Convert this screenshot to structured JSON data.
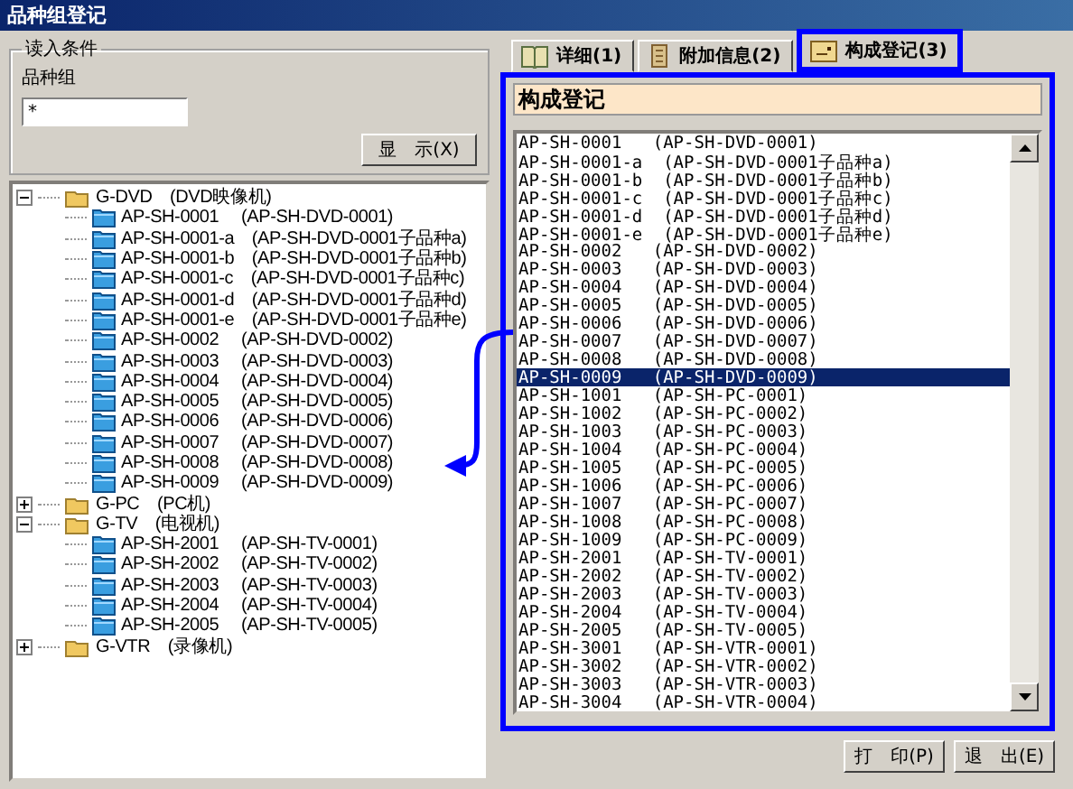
{
  "window": {
    "title": "品种组登记"
  },
  "query": {
    "legend": "读入条件",
    "field_label": "品种组",
    "field_value": "*",
    "button": "显　示(X)"
  },
  "tree": [
    {
      "label": "G-DVD　(DVD映像机)",
      "expanded": true,
      "children": [
        {
          "label": "AP-SH-0001　 (AP-SH-DVD-0001)"
        },
        {
          "label": "AP-SH-0001-a　(AP-SH-DVD-0001子品种a)"
        },
        {
          "label": "AP-SH-0001-b　(AP-SH-DVD-0001子品种b)"
        },
        {
          "label": "AP-SH-0001-c　(AP-SH-DVD-0001子品种c)"
        },
        {
          "label": "AP-SH-0001-d　(AP-SH-DVD-0001子品种d)"
        },
        {
          "label": "AP-SH-0001-e　(AP-SH-DVD-0001子品种e)"
        },
        {
          "label": "AP-SH-0002　 (AP-SH-DVD-0002)"
        },
        {
          "label": "AP-SH-0003　 (AP-SH-DVD-0003)"
        },
        {
          "label": "AP-SH-0004　 (AP-SH-DVD-0004)"
        },
        {
          "label": "AP-SH-0005　 (AP-SH-DVD-0005)"
        },
        {
          "label": "AP-SH-0006　 (AP-SH-DVD-0006)"
        },
        {
          "label": "AP-SH-0007　 (AP-SH-DVD-0007)"
        },
        {
          "label": "AP-SH-0008　 (AP-SH-DVD-0008)"
        },
        {
          "label": "AP-SH-0009　 (AP-SH-DVD-0009)"
        }
      ]
    },
    {
      "label": "G-PC　(PC机)",
      "expanded": false
    },
    {
      "label": "G-TV　(电视机)",
      "expanded": true,
      "children": [
        {
          "label": "AP-SH-2001　 (AP-SH-TV-0001)"
        },
        {
          "label": "AP-SH-2002　 (AP-SH-TV-0002)"
        },
        {
          "label": "AP-SH-2003　 (AP-SH-TV-0003)"
        },
        {
          "label": "AP-SH-2004　 (AP-SH-TV-0004)"
        },
        {
          "label": "AP-SH-2005　 (AP-SH-TV-0005)"
        }
      ]
    },
    {
      "label": "G-VTR　(录像机)",
      "expanded": false
    }
  ],
  "tabs": [
    {
      "label": "详细(1)",
      "selected": false
    },
    {
      "label": "附加信息(2)",
      "selected": false
    },
    {
      "label": "构成登记(3)",
      "selected": true
    }
  ],
  "panel": {
    "heading": "构成登记"
  },
  "list": [
    {
      "text": "AP-SH-0001   (AP-SH-DVD-0001)",
      "selected": false
    },
    {
      "text": "AP-SH-0001-a  (AP-SH-DVD-0001子品种a)",
      "selected": false
    },
    {
      "text": "AP-SH-0001-b  (AP-SH-DVD-0001子品种b)",
      "selected": false
    },
    {
      "text": "AP-SH-0001-c  (AP-SH-DVD-0001子品种c)",
      "selected": false
    },
    {
      "text": "AP-SH-0001-d  (AP-SH-DVD-0001子品种d)",
      "selected": false
    },
    {
      "text": "AP-SH-0001-e  (AP-SH-DVD-0001子品种e)",
      "selected": false
    },
    {
      "text": "AP-SH-0002   (AP-SH-DVD-0002)",
      "selected": false
    },
    {
      "text": "AP-SH-0003   (AP-SH-DVD-0003)",
      "selected": false
    },
    {
      "text": "AP-SH-0004   (AP-SH-DVD-0004)",
      "selected": false
    },
    {
      "text": "AP-SH-0005   (AP-SH-DVD-0005)",
      "selected": false
    },
    {
      "text": "AP-SH-0006   (AP-SH-DVD-0006)",
      "selected": false
    },
    {
      "text": "AP-SH-0007   (AP-SH-DVD-0007)",
      "selected": false
    },
    {
      "text": "AP-SH-0008   (AP-SH-DVD-0008)",
      "selected": false
    },
    {
      "text": "AP-SH-0009   (AP-SH-DVD-0009)",
      "selected": true
    },
    {
      "text": "AP-SH-1001   (AP-SH-PC-0001)",
      "selected": false
    },
    {
      "text": "AP-SH-1002   (AP-SH-PC-0002)",
      "selected": false
    },
    {
      "text": "AP-SH-1003   (AP-SH-PC-0003)",
      "selected": false
    },
    {
      "text": "AP-SH-1004   (AP-SH-PC-0004)",
      "selected": false
    },
    {
      "text": "AP-SH-1005   (AP-SH-PC-0005)",
      "selected": false
    },
    {
      "text": "AP-SH-1006   (AP-SH-PC-0006)",
      "selected": false
    },
    {
      "text": "AP-SH-1007   (AP-SH-PC-0007)",
      "selected": false
    },
    {
      "text": "AP-SH-1008   (AP-SH-PC-0008)",
      "selected": false
    },
    {
      "text": "AP-SH-1009   (AP-SH-PC-0009)",
      "selected": false
    },
    {
      "text": "AP-SH-2001   (AP-SH-TV-0001)",
      "selected": false
    },
    {
      "text": "AP-SH-2002   (AP-SH-TV-0002)",
      "selected": false
    },
    {
      "text": "AP-SH-2003   (AP-SH-TV-0003)",
      "selected": false
    },
    {
      "text": "AP-SH-2004   (AP-SH-TV-0004)",
      "selected": false
    },
    {
      "text": "AP-SH-2005   (AP-SH-TV-0005)",
      "selected": false
    },
    {
      "text": "AP-SH-3001   (AP-SH-VTR-0001)",
      "selected": false
    },
    {
      "text": "AP-SH-3002   (AP-SH-VTR-0002)",
      "selected": false
    },
    {
      "text": "AP-SH-3003   (AP-SH-VTR-0003)",
      "selected": false
    },
    {
      "text": "AP-SH-3004   (AP-SH-VTR-0004)",
      "selected": false
    }
  ],
  "buttons": [
    "打　印(P)",
    "退　出(E)"
  ]
}
